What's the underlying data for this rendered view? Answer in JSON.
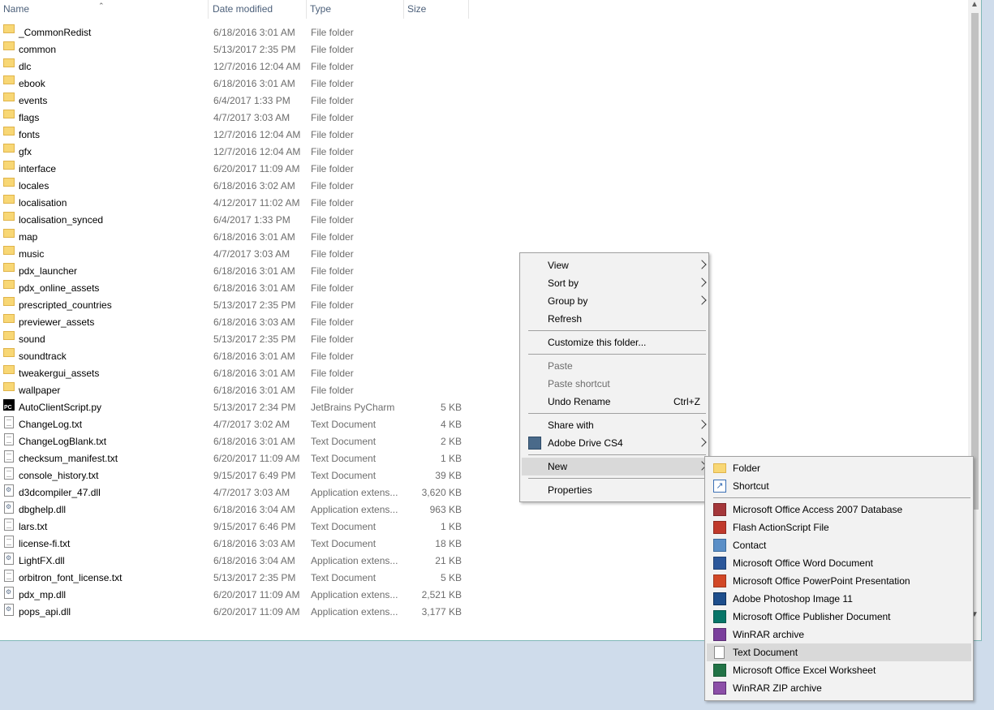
{
  "columns": {
    "name": "Name",
    "date": "Date modified",
    "type": "Type",
    "size": "Size"
  },
  "files": [
    {
      "name": "_CommonRedist",
      "date": "6/18/2016 3:01 AM",
      "type": "File folder",
      "size": "",
      "icon": "folder-icon"
    },
    {
      "name": "common",
      "date": "5/13/2017 2:35 PM",
      "type": "File folder",
      "size": "",
      "icon": "folder-icon"
    },
    {
      "name": "dlc",
      "date": "12/7/2016 12:04 AM",
      "type": "File folder",
      "size": "",
      "icon": "folder-icon"
    },
    {
      "name": "ebook",
      "date": "6/18/2016 3:01 AM",
      "type": "File folder",
      "size": "",
      "icon": "folder-icon"
    },
    {
      "name": "events",
      "date": "6/4/2017 1:33 PM",
      "type": "File folder",
      "size": "",
      "icon": "folder-icon"
    },
    {
      "name": "flags",
      "date": "4/7/2017 3:03 AM",
      "type": "File folder",
      "size": "",
      "icon": "folder-icon"
    },
    {
      "name": "fonts",
      "date": "12/7/2016 12:04 AM",
      "type": "File folder",
      "size": "",
      "icon": "folder-icon"
    },
    {
      "name": "gfx",
      "date": "12/7/2016 12:04 AM",
      "type": "File folder",
      "size": "",
      "icon": "folder-icon"
    },
    {
      "name": "interface",
      "date": "6/20/2017 11:09 AM",
      "type": "File folder",
      "size": "",
      "icon": "folder-icon"
    },
    {
      "name": "locales",
      "date": "6/18/2016 3:02 AM",
      "type": "File folder",
      "size": "",
      "icon": "folder-icon"
    },
    {
      "name": "localisation",
      "date": "4/12/2017 11:02 AM",
      "type": "File folder",
      "size": "",
      "icon": "folder-icon"
    },
    {
      "name": "localisation_synced",
      "date": "6/4/2017 1:33 PM",
      "type": "File folder",
      "size": "",
      "icon": "folder-icon"
    },
    {
      "name": "map",
      "date": "6/18/2016 3:01 AM",
      "type": "File folder",
      "size": "",
      "icon": "folder-icon"
    },
    {
      "name": "music",
      "date": "4/7/2017 3:03 AM",
      "type": "File folder",
      "size": "",
      "icon": "folder-icon"
    },
    {
      "name": "pdx_launcher",
      "date": "6/18/2016 3:01 AM",
      "type": "File folder",
      "size": "",
      "icon": "folder-icon"
    },
    {
      "name": "pdx_online_assets",
      "date": "6/18/2016 3:01 AM",
      "type": "File folder",
      "size": "",
      "icon": "folder-icon"
    },
    {
      "name": "prescripted_countries",
      "date": "5/13/2017 2:35 PM",
      "type": "File folder",
      "size": "",
      "icon": "folder-icon"
    },
    {
      "name": "previewer_assets",
      "date": "6/18/2016 3:03 AM",
      "type": "File folder",
      "size": "",
      "icon": "folder-icon"
    },
    {
      "name": "sound",
      "date": "5/13/2017 2:35 PM",
      "type": "File folder",
      "size": "",
      "icon": "folder-icon"
    },
    {
      "name": "soundtrack",
      "date": "6/18/2016 3:01 AM",
      "type": "File folder",
      "size": "",
      "icon": "folder-icon"
    },
    {
      "name": "tweakergui_assets",
      "date": "6/18/2016 3:01 AM",
      "type": "File folder",
      "size": "",
      "icon": "folder-icon"
    },
    {
      "name": "wallpaper",
      "date": "6/18/2016 3:01 AM",
      "type": "File folder",
      "size": "",
      "icon": "folder-icon"
    },
    {
      "name": "AutoClientScript.py",
      "date": "5/13/2017 2:34 PM",
      "type": "JetBrains PyCharm",
      "size": "5 KB",
      "icon": "pycharm-icon"
    },
    {
      "name": "ChangeLog.txt",
      "date": "4/7/2017 3:02 AM",
      "type": "Text Document",
      "size": "4 KB",
      "icon": "text-file-icon"
    },
    {
      "name": "ChangeLogBlank.txt",
      "date": "6/18/2016 3:01 AM",
      "type": "Text Document",
      "size": "2 KB",
      "icon": "text-file-icon"
    },
    {
      "name": "checksum_manifest.txt",
      "date": "6/20/2017 11:09 AM",
      "type": "Text Document",
      "size": "1 KB",
      "icon": "text-file-icon"
    },
    {
      "name": "console_history.txt",
      "date": "9/15/2017 6:49 PM",
      "type": "Text Document",
      "size": "39 KB",
      "icon": "text-file-icon"
    },
    {
      "name": "d3dcompiler_47.dll",
      "date": "4/7/2017 3:03 AM",
      "type": "Application extens...",
      "size": "3,620 KB",
      "icon": "dll-file-icon"
    },
    {
      "name": "dbghelp.dll",
      "date": "6/18/2016 3:04 AM",
      "type": "Application extens...",
      "size": "963 KB",
      "icon": "dll-file-icon"
    },
    {
      "name": "lars.txt",
      "date": "9/15/2017 6:46 PM",
      "type": "Text Document",
      "size": "1 KB",
      "icon": "text-file-icon"
    },
    {
      "name": "license-fi.txt",
      "date": "6/18/2016 3:03 AM",
      "type": "Text Document",
      "size": "18 KB",
      "icon": "text-file-icon"
    },
    {
      "name": "LightFX.dll",
      "date": "6/18/2016 3:04 AM",
      "type": "Application extens...",
      "size": "21 KB",
      "icon": "dll-file-icon"
    },
    {
      "name": "orbitron_font_license.txt",
      "date": "5/13/2017 2:35 PM",
      "type": "Text Document",
      "size": "5 KB",
      "icon": "text-file-icon"
    },
    {
      "name": "pdx_mp.dll",
      "date": "6/20/2017 11:09 AM",
      "type": "Application extens...",
      "size": "2,521 KB",
      "icon": "dll-file-icon"
    },
    {
      "name": "pops_api.dll",
      "date": "6/20/2017 11:09 AM",
      "type": "Application extens...",
      "size": "3,177 KB",
      "icon": "dll-file-icon"
    }
  ],
  "context_menu": [
    {
      "label": "View",
      "submenu": true,
      "disabled": false
    },
    {
      "label": "Sort by",
      "submenu": true,
      "disabled": false
    },
    {
      "label": "Group by",
      "submenu": true,
      "disabled": false
    },
    {
      "label": "Refresh",
      "submenu": false,
      "disabled": false
    },
    {
      "sep": true
    },
    {
      "label": "Customize this folder...",
      "submenu": false,
      "disabled": false
    },
    {
      "sep": true
    },
    {
      "label": "Paste",
      "submenu": false,
      "disabled": true
    },
    {
      "label": "Paste shortcut",
      "submenu": false,
      "disabled": true
    },
    {
      "label": "Undo Rename",
      "shortcut": "Ctrl+Z",
      "submenu": false,
      "disabled": false
    },
    {
      "sep": true
    },
    {
      "label": "Share with",
      "submenu": true,
      "disabled": false
    },
    {
      "label": "Adobe Drive CS4",
      "submenu": true,
      "disabled": false,
      "icon": "adobe-drive-icon"
    },
    {
      "sep": true
    },
    {
      "label": "New",
      "submenu": true,
      "disabled": false,
      "highlighted": true
    },
    {
      "sep": true
    },
    {
      "label": "Properties",
      "submenu": false,
      "disabled": false
    }
  ],
  "new_submenu": [
    {
      "label": "Folder",
      "icon": "folder-icon"
    },
    {
      "label": "Shortcut",
      "icon": "shortcut-icon"
    },
    {
      "sep": true
    },
    {
      "label": "Microsoft Office Access 2007 Database",
      "icon": "access-icon"
    },
    {
      "label": "Flash ActionScript File",
      "icon": "flash-icon"
    },
    {
      "label": "Contact",
      "icon": "contact-icon"
    },
    {
      "label": "Microsoft Office Word Document",
      "icon": "word-icon"
    },
    {
      "label": "Microsoft Office PowerPoint Presentation",
      "icon": "powerpoint-icon"
    },
    {
      "label": "Adobe Photoshop Image 11",
      "icon": "photoshop-icon"
    },
    {
      "label": "Microsoft Office Publisher Document",
      "icon": "publisher-icon"
    },
    {
      "label": "WinRAR archive",
      "icon": "winrar-icon"
    },
    {
      "label": "Text Document",
      "icon": "text-file-icon",
      "highlighted": true
    },
    {
      "label": "Microsoft Office Excel Worksheet",
      "icon": "excel-icon"
    },
    {
      "label": "WinRAR ZIP archive",
      "icon": "winrar-zip-icon"
    }
  ],
  "colors": {
    "accent": "#4c607a",
    "window_border": "#7fb7b7",
    "desktop": "#cfdceb",
    "highlight": "#d9d9d9"
  }
}
